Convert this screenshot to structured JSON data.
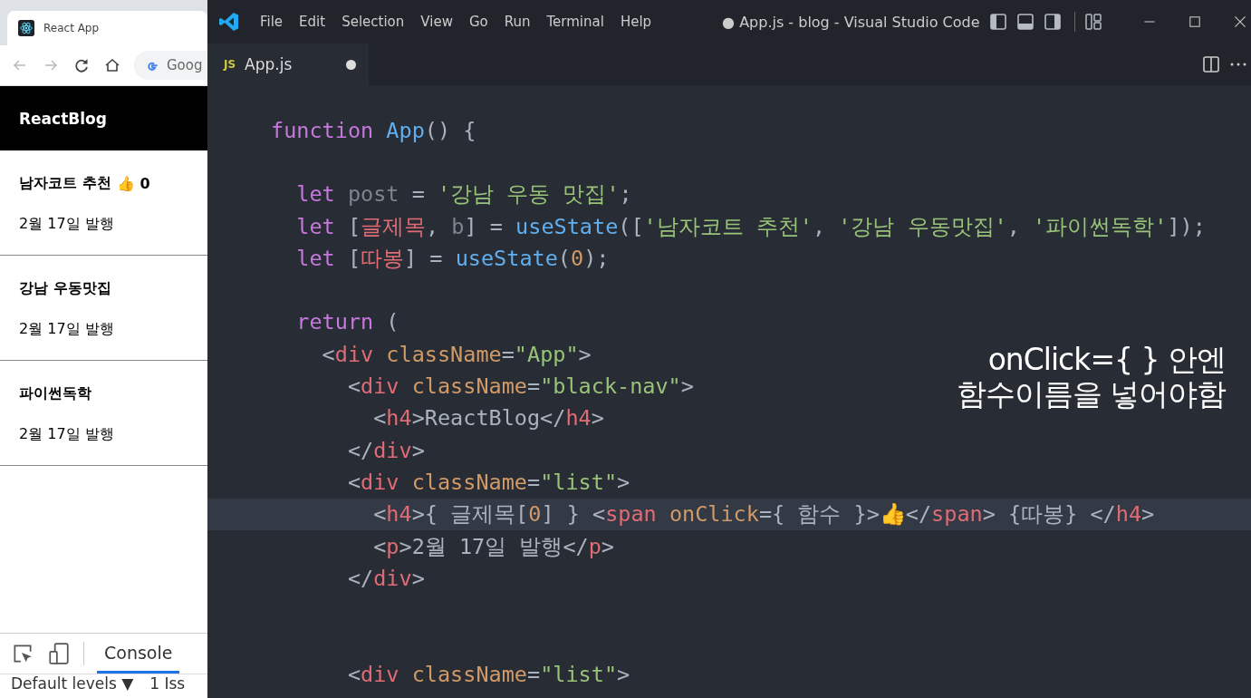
{
  "browser": {
    "tab_title": "React App",
    "address": "Goog",
    "nav_title": "ReactBlog",
    "posts": [
      {
        "title": "남자코트 추천",
        "like_icon": "👍",
        "likes": "0",
        "date": "2월 17일 발행"
      },
      {
        "title": "강남 우동맛집",
        "date": "2월 17일 발행"
      },
      {
        "title": "파이썬독학",
        "date": "2월 17일 발행"
      }
    ],
    "devtools": {
      "tabs": [
        {
          "label": "Console",
          "selected": true
        }
      ],
      "levels": "Default levels ▼",
      "issues": "1 Iss"
    }
  },
  "editor": {
    "menu": [
      "File",
      "Edit",
      "Selection",
      "View",
      "Go",
      "Run",
      "Terminal",
      "Help"
    ],
    "window_title": "● App.js - blog - Visual Studio Code",
    "file_tab": {
      "badge": "JS",
      "name": "App.js",
      "modified": true
    },
    "lines": [
      {
        "kind": "code",
        "current": false,
        "tokens": [
          {
            "kind": "kw",
            "t": "function "
          },
          {
            "kind": "fn",
            "t": "App"
          },
          {
            "kind": "p",
            "t": "() {"
          }
        ]
      },
      {
        "kind": "blank",
        "current": false
      },
      {
        "kind": "code",
        "current": false,
        "tokens": [
          {
            "kind": "kw",
            "t": "  let "
          },
          {
            "kind": "dim",
            "t": "post"
          },
          {
            "kind": "p",
            "t": " = "
          },
          {
            "kind": "str",
            "t": "'강남 우동 맛집'"
          },
          {
            "kind": "p",
            "t": ";"
          }
        ]
      },
      {
        "kind": "code",
        "current": false,
        "tokens": [
          {
            "kind": "kw",
            "t": "  let "
          },
          {
            "kind": "p",
            "t": "["
          },
          {
            "kind": "var",
            "t": "글제목"
          },
          {
            "kind": "p",
            "t": ", "
          },
          {
            "kind": "dim",
            "t": "b"
          },
          {
            "kind": "p",
            "t": "] = "
          },
          {
            "kind": "fn",
            "t": "useState"
          },
          {
            "kind": "p",
            "t": "(["
          },
          {
            "kind": "str",
            "t": "'남자코트 추천'"
          },
          {
            "kind": "p",
            "t": ", "
          },
          {
            "kind": "str",
            "t": "'강남 우동맛집'"
          },
          {
            "kind": "p",
            "t": ", "
          },
          {
            "kind": "str",
            "t": "'파이썬독학'"
          },
          {
            "kind": "p",
            "t": "]);"
          }
        ]
      },
      {
        "kind": "code",
        "current": false,
        "tokens": [
          {
            "kind": "kw",
            "t": "  let "
          },
          {
            "kind": "p",
            "t": "["
          },
          {
            "kind": "var",
            "t": "따봉"
          },
          {
            "kind": "p",
            "t": "] = "
          },
          {
            "kind": "fn",
            "t": "useState"
          },
          {
            "kind": "p",
            "t": "("
          },
          {
            "kind": "num",
            "t": "0"
          },
          {
            "kind": "p",
            "t": ");"
          }
        ]
      },
      {
        "kind": "blank",
        "current": false
      },
      {
        "kind": "code",
        "current": false,
        "tokens": [
          {
            "kind": "kw",
            "t": "  return"
          },
          {
            "kind": "p",
            "t": " ("
          }
        ]
      },
      {
        "kind": "code",
        "current": false,
        "tokens": [
          {
            "kind": "p",
            "t": "    <"
          },
          {
            "kind": "tag",
            "t": "div"
          },
          {
            "kind": "attr",
            "t": " className"
          },
          {
            "kind": "p",
            "t": "="
          },
          {
            "kind": "str",
            "t": "\"App\""
          },
          {
            "kind": "p",
            "t": ">"
          }
        ]
      },
      {
        "kind": "code",
        "current": false,
        "tokens": [
          {
            "kind": "p",
            "t": "      <"
          },
          {
            "kind": "tag",
            "t": "div"
          },
          {
            "kind": "attr",
            "t": " className"
          },
          {
            "kind": "p",
            "t": "="
          },
          {
            "kind": "str",
            "t": "\"black-nav\""
          },
          {
            "kind": "p",
            "t": ">"
          }
        ]
      },
      {
        "kind": "code",
        "current": false,
        "tokens": [
          {
            "kind": "p",
            "t": "        <"
          },
          {
            "kind": "tag",
            "t": "h4"
          },
          {
            "kind": "p",
            "t": ">ReactBlog</"
          },
          {
            "kind": "tag",
            "t": "h4"
          },
          {
            "kind": "p",
            "t": ">"
          }
        ]
      },
      {
        "kind": "code",
        "current": false,
        "tokens": [
          {
            "kind": "p",
            "t": "      </"
          },
          {
            "kind": "tag",
            "t": "div"
          },
          {
            "kind": "p",
            "t": ">"
          }
        ]
      },
      {
        "kind": "code",
        "current": false,
        "tokens": [
          {
            "kind": "p",
            "t": "      <"
          },
          {
            "kind": "tag",
            "t": "div"
          },
          {
            "kind": "attr",
            "t": " className"
          },
          {
            "kind": "p",
            "t": "="
          },
          {
            "kind": "str",
            "t": "\"list\""
          },
          {
            "kind": "p",
            "t": ">"
          }
        ]
      },
      {
        "kind": "code",
        "current": true,
        "tokens": [
          {
            "kind": "p",
            "t": "        <"
          },
          {
            "kind": "tag",
            "t": "h4"
          },
          {
            "kind": "p",
            "t": ">{ 글제목["
          },
          {
            "kind": "num",
            "t": "0"
          },
          {
            "kind": "p",
            "t": "] } <"
          },
          {
            "kind": "tag",
            "t": "span"
          },
          {
            "kind": "attr",
            "t": " onClick"
          },
          {
            "kind": "p",
            "t": "={ 함수 }>👍</"
          },
          {
            "kind": "tag",
            "t": "span"
          },
          {
            "kind": "p",
            "t": "> {따봉} </"
          },
          {
            "kind": "tag",
            "t": "h4"
          },
          {
            "kind": "p",
            "t": ">"
          }
        ]
      },
      {
        "kind": "code",
        "current": false,
        "tokens": [
          {
            "kind": "p",
            "t": "        <"
          },
          {
            "kind": "tag",
            "t": "p"
          },
          {
            "kind": "p",
            "t": ">2월 17일 발행</"
          },
          {
            "kind": "tag",
            "t": "p"
          },
          {
            "kind": "p",
            "t": ">"
          }
        ]
      },
      {
        "kind": "code",
        "current": false,
        "tokens": [
          {
            "kind": "p",
            "t": "      </"
          },
          {
            "kind": "tag",
            "t": "div"
          },
          {
            "kind": "p",
            "t": ">"
          }
        ]
      },
      {
        "kind": "blank",
        "current": false
      },
      {
        "kind": "blank",
        "current": false
      },
      {
        "kind": "code",
        "current": false,
        "tokens": [
          {
            "kind": "p",
            "t": "      <"
          },
          {
            "kind": "tag",
            "t": "div"
          },
          {
            "kind": "attr",
            "t": " className"
          },
          {
            "kind": "p",
            "t": "="
          },
          {
            "kind": "str",
            "t": "\"list\""
          },
          {
            "kind": "p",
            "t": ">"
          }
        ]
      }
    ]
  },
  "caption": [
    "onClick={ } 안엔",
    "함수이름을 넣어야함"
  ]
}
